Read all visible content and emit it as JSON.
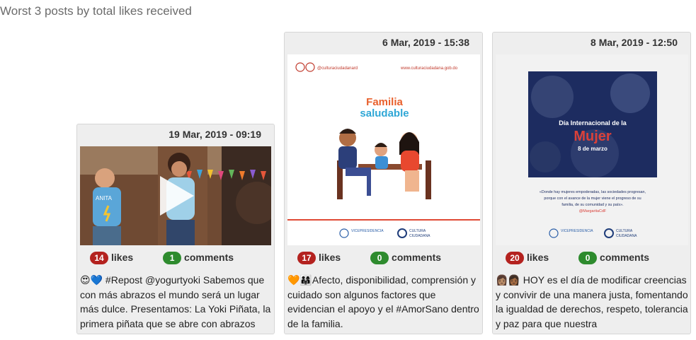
{
  "page": {
    "title": "Worst 3 posts by total likes received"
  },
  "posts": [
    {
      "date": "19 Mar, 2019 - 09:19",
      "likes": "14",
      "likes_label": "likes",
      "comments": "1",
      "comments_label": "comments",
      "caption": "😍💙 #Repost @yogurtyoki Sabemos que con más abrazos el mundo será un lugar más dulce. Presentamos: La Yoki Piñata, la primera piñata que se abre con abrazos",
      "media": {
        "shirt_text": "ANITA"
      }
    },
    {
      "date": "6 Mar, 2019 - 15:38",
      "likes": "17",
      "likes_label": "likes",
      "comments": "0",
      "comments_label": "comments",
      "caption": "🧡👨‍👩‍👧Afecto, disponibilidad, comprensión y cuidado son algunos factores que evidencian el apoyo y el #AmorSano dentro de la familia.",
      "media": {
        "handle": "@culturaciudadanard",
        "website": "www.culturaciudadana.gob.do",
        "heading_line1": "Familia",
        "heading_line2": "saludable",
        "logo1": "VICEPRESIDENCIA",
        "logo2_line1": "CULTURA",
        "logo2_line2": "CIUDADANA"
      }
    },
    {
      "date": "8 Mar, 2019 - 12:50",
      "likes": "20",
      "likes_label": "likes",
      "comments": "0",
      "comments_label": "comments",
      "caption": "👩🏽👩🏾 HOY es el día de modificar creencias y convivir de una manera justa, fomentando la igualdad de derechos, respeto, tolerancia y paz para que nuestra",
      "media": {
        "line1": "Día Internacional de la",
        "line2": "Mujer",
        "line3": "8 de marzo",
        "quote_line1": "«Donde hay mujeres empoderadas, las sociedades progresan,",
        "quote_line2": "porque con el avance de la mujer viene el progreso de su",
        "quote_line3": "familia, de su comunidad y su país».",
        "quote_handle": "@MargaritaCdF",
        "logo1": "VICEPRESIDENCIA",
        "logo2_line1": "CULTURA",
        "logo2_line2": "CIUDADANA"
      }
    }
  ]
}
